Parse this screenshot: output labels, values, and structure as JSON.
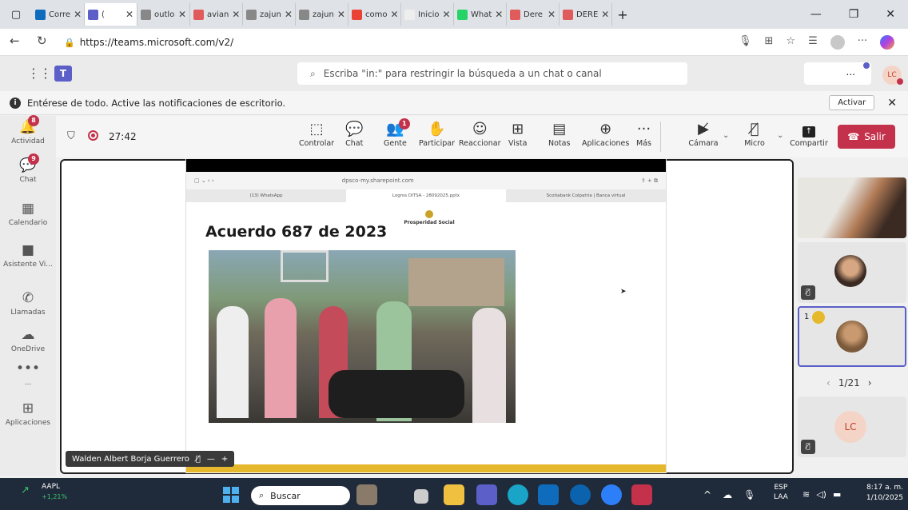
{
  "browser": {
    "tabs": [
      {
        "label": "Corre",
        "color": "#0f6cbd"
      },
      {
        "label": "(",
        "color": "#5b5fc7",
        "active": true
      },
      {
        "label": "outlo",
        "color": "#888"
      },
      {
        "label": "avian",
        "color": "#e05b5b"
      },
      {
        "label": "zajun",
        "color": "#888"
      },
      {
        "label": "zajun",
        "color": "#888"
      },
      {
        "label": "como",
        "color": "#ea4335"
      },
      {
        "label": "Inicio",
        "color": "#eee"
      },
      {
        "label": "What",
        "color": "#25d366"
      },
      {
        "label": "Dere",
        "color": "#e05b5b"
      },
      {
        "label": "DERE",
        "color": "#e05b5b"
      }
    ],
    "new_tab": "+",
    "url": "https://teams.microsoft.com/v2/"
  },
  "teams": {
    "search_placeholder": "Escriba \"in:\" para restringir la búsqueda a un chat o canal",
    "more": "...",
    "avatar_initials": "LC",
    "notification": "Entérese de todo. Active las notificaciones de escritorio.",
    "activate_label": "Activar",
    "rail": [
      {
        "label": "Actividad",
        "badge": "8"
      },
      {
        "label": "Chat",
        "badge": "9"
      },
      {
        "label": "Calendario",
        "badge": ""
      },
      {
        "label": "Asistente Vi...",
        "badge": ""
      },
      {
        "label": "Llamadas",
        "badge": ""
      },
      {
        "label": "OneDrive",
        "badge": ""
      },
      {
        "label": "...",
        "badge": ""
      },
      {
        "label": "Aplicaciones",
        "badge": ""
      }
    ],
    "meeting_timer": "27:42",
    "tools": [
      {
        "label": "Controlar",
        "icon": "⬚"
      },
      {
        "label": "Chat",
        "icon": "💬"
      },
      {
        "label": "Gente",
        "icon": "👥",
        "badge": "1"
      },
      {
        "label": "Participar",
        "icon": "✋"
      },
      {
        "label": "Reaccionar",
        "icon": "☺"
      },
      {
        "label": "Vista",
        "icon": "⊞"
      },
      {
        "label": "Notas",
        "icon": "▤"
      },
      {
        "label": "Aplicaciones",
        "icon": "⊕"
      },
      {
        "label": "Más",
        "icon": "···"
      }
    ],
    "camera_label": "Cámara",
    "mic_label": "Micro",
    "share_label": "Compartir",
    "leave_label": "Salir",
    "presenter_name": "Walden Albert Borja Guerrero",
    "page_indicator": "1/21",
    "tile_count": "1",
    "tile_initials": "LC"
  },
  "slide": {
    "mini_url": "dpsco-my.sharepoint.com",
    "mini_tabs": [
      "(13) WhatsApp",
      "Logros DITSA - 28092025.pptx",
      "Scotiabank Colpatria | Banca virtual"
    ],
    "title": "Acuerdo 687 de 2023",
    "logo_text": "Prosperidad Social"
  },
  "taskbar": {
    "stock_symbol": "AAPL",
    "stock_change": "+1,21%",
    "search_label": "Buscar",
    "lang_top": "ESP",
    "lang_bottom": "LAA",
    "time": "8:17 a. m.",
    "date": "1/10/2025"
  }
}
